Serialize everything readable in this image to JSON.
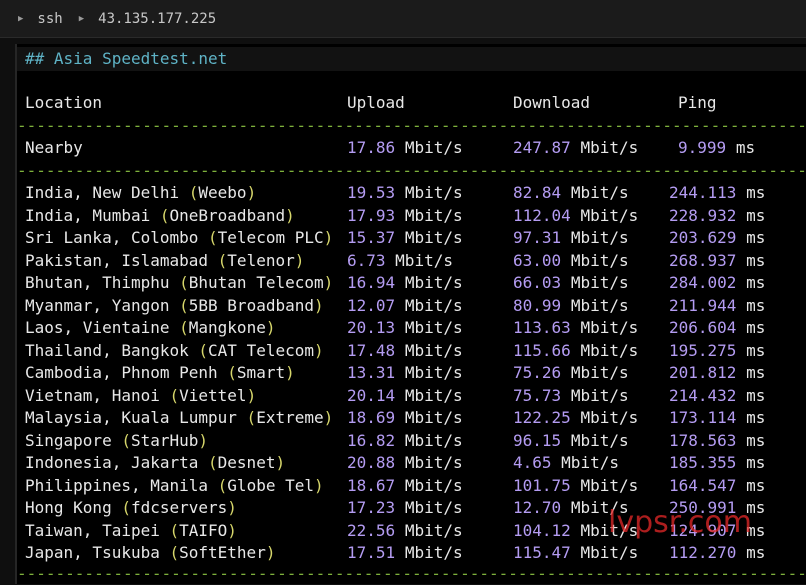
{
  "titlebar": {
    "items": [
      "ssh",
      "43.135.177.225"
    ]
  },
  "heading": "## Asia Speedtest.net",
  "columns": {
    "location": "Location",
    "upload": "Upload",
    "download": "Download",
    "ping": "Ping"
  },
  "divider": "------------------------------------------------------------------------------------",
  "nearby": {
    "location": "Nearby",
    "upload_num": "17.86",
    "upload_unit": "Mbit/s",
    "download_num": "247.87",
    "download_unit": "Mbit/s",
    "ping_num": "9.999",
    "ping_unit": "ms"
  },
  "rows": [
    {
      "place": "India, New Delhi",
      "isp": "Weebo",
      "up": "19.53",
      "down": "82.84",
      "ping": "244.113"
    },
    {
      "place": "India, Mumbai",
      "isp": "OneBroadband",
      "up": "17.93",
      "down": "112.04",
      "ping": "228.932"
    },
    {
      "place": "Sri Lanka, Colombo",
      "isp": "Telecom PLC",
      "up": "15.37",
      "down": "97.31",
      "ping": "203.629"
    },
    {
      "place": "Pakistan, Islamabad",
      "isp": "Telenor",
      "up": "6.73",
      "down": "63.00",
      "ping": "268.937"
    },
    {
      "place": "Bhutan, Thimphu",
      "isp": "Bhutan Telecom",
      "up": "16.94",
      "down": "66.03",
      "ping": "284.002"
    },
    {
      "place": "Myanmar, Yangon",
      "isp": "5BB Broadband",
      "up": "12.07",
      "down": "80.99",
      "ping": "211.944"
    },
    {
      "place": "Laos, Vientaine",
      "isp": "Mangkone",
      "up": "20.13",
      "down": "113.63",
      "ping": "206.604"
    },
    {
      "place": "Thailand, Bangkok",
      "isp": "CAT Telecom",
      "up": "17.48",
      "down": "115.66",
      "ping": "195.275"
    },
    {
      "place": "Cambodia, Phnom Penh",
      "isp": "Smart",
      "up": "13.31",
      "down": "75.26",
      "ping": "201.812"
    },
    {
      "place": "Vietnam, Hanoi",
      "isp": "Viettel",
      "up": "20.14",
      "down": "75.73",
      "ping": "214.432"
    },
    {
      "place": "Malaysia, Kuala Lumpur",
      "isp": "Extreme",
      "up": "18.69",
      "down": "122.25",
      "ping": "173.114"
    },
    {
      "place": "Singapore",
      "isp": "StarHub",
      "up": "16.82",
      "down": "96.15",
      "ping": "178.563"
    },
    {
      "place": "Indonesia, Jakarta",
      "isp": "Desnet",
      "up": "20.88",
      "down": "4.65",
      "ping": "185.355"
    },
    {
      "place": "Philippines, Manila",
      "isp": "Globe Tel",
      "up": "18.67",
      "down": "101.75",
      "ping": "164.547"
    },
    {
      "place": "Hong Kong",
      "isp": "fdcservers",
      "up": "17.23",
      "down": "12.70",
      "ping": "250.991"
    },
    {
      "place": "Taiwan, Taipei",
      "isp": "TAIFO",
      "up": "22.56",
      "down": "104.12",
      "ping": "124.907"
    },
    {
      "place": "Japan, Tsukuba",
      "isp": "SoftEther",
      "up": "17.51",
      "down": "115.47",
      "ping": "112.270"
    }
  ],
  "units": {
    "speed": "Mbit/s",
    "ping": "ms"
  },
  "watermark": "lvpsr.com",
  "colors": {
    "number": "#b49cf2",
    "heading": "#5fb3c6",
    "divider": "#7eb13c",
    "paren": "#d6d66b"
  }
}
